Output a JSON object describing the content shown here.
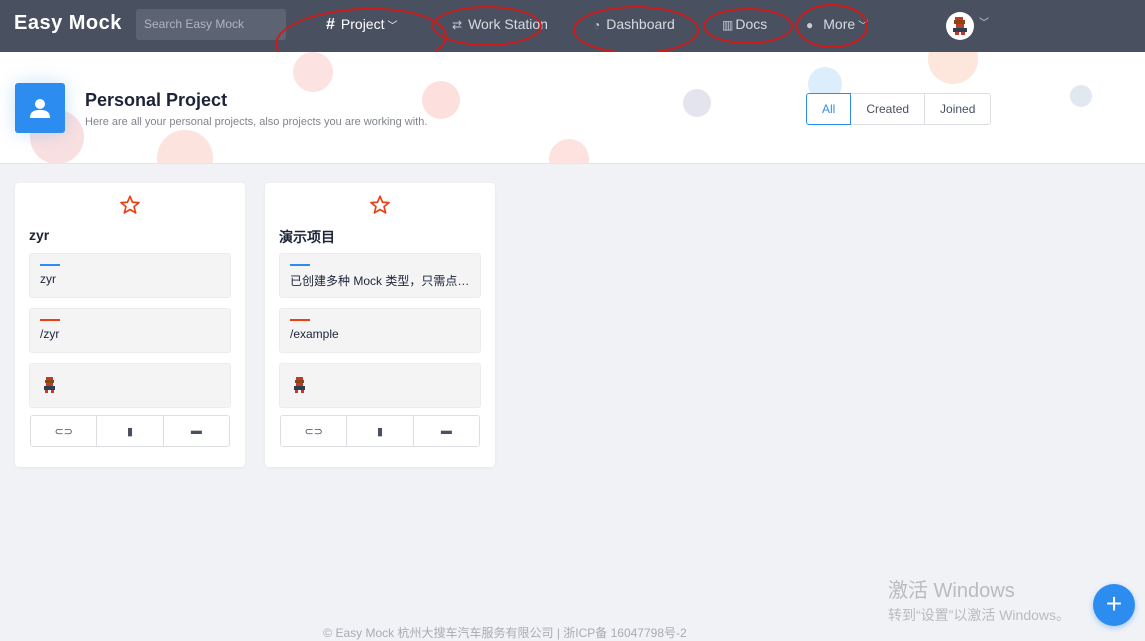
{
  "brand": "Easy Mock",
  "search": {
    "placeholder": "Search Easy Mock"
  },
  "nav": {
    "project": "Project",
    "workstation": "Work Station",
    "dashboard": "Dashboard",
    "docs": "Docs",
    "more": "More"
  },
  "header": {
    "title": "Personal Project",
    "subtitle": "Here are all your personal projects, also projects you are working with.",
    "filters": [
      "All",
      "Created",
      "Joined"
    ],
    "active_filter": "All"
  },
  "projects": [
    {
      "name": "zyr",
      "description": "zyr",
      "url": "/zyr"
    },
    {
      "name": "演示项目",
      "description": "已创建多种 Mock 类型，只需点击预览便可查看效果。",
      "url": "/example"
    }
  ],
  "footer": "© Easy Mock 杭州大搜车汽车服务有限公司 | 浙ICP备 16047798号-2",
  "watermark": {
    "line1": "激活 Windows",
    "line2": "转到“设置”以激活 Windows。"
  },
  "colors": {
    "primary": "#2d8cf0",
    "topbar": "#495060",
    "star": "#ed3f14",
    "desc_bar": "#2d8cf0",
    "url_bar": "#ed3f14"
  },
  "icons": [
    "hash-icon",
    "chevron-down-icon",
    "swap-icon",
    "speedometer-icon",
    "book-icon",
    "egg-icon",
    "user-icon",
    "star-icon",
    "link-icon",
    "copy-icon",
    "trash-icon",
    "plus-icon"
  ]
}
